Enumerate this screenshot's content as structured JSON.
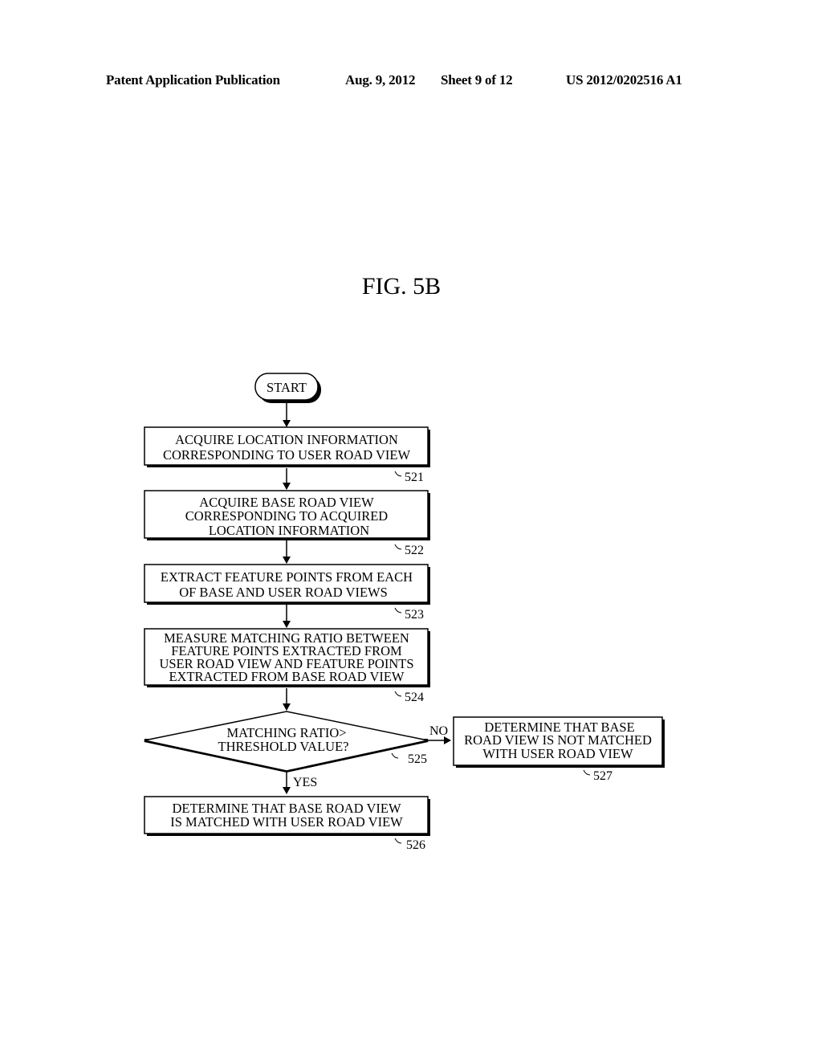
{
  "header": {
    "publication": "Patent Application Publication",
    "date": "Aug. 9, 2012",
    "sheet": "Sheet 9 of 12",
    "pub_number": "US 2012/0202516 A1"
  },
  "figure": {
    "title": "FIG. 5B"
  },
  "flowchart": {
    "start": {
      "label": "START"
    },
    "steps": [
      {
        "ref": "521",
        "lines": [
          "ACQUIRE LOCATION INFORMATION",
          "CORRESPONDING TO USER ROAD VIEW"
        ]
      },
      {
        "ref": "522",
        "lines": [
          "ACQUIRE BASE ROAD VIEW",
          "CORRESPONDING TO ACQUIRED",
          "LOCATION INFORMATION"
        ]
      },
      {
        "ref": "523",
        "lines": [
          "EXTRACT FEATURE POINTS FROM EACH",
          "OF BASE AND USER ROAD VIEWS"
        ]
      },
      {
        "ref": "524",
        "lines": [
          "MEASURE MATCHING RATIO BETWEEN",
          "FEATURE POINTS EXTRACTED FROM",
          "USER ROAD VIEW AND FEATURE POINTS",
          "EXTRACTED FROM BASE ROAD VIEW"
        ]
      }
    ],
    "decision": {
      "ref": "525",
      "lines": [
        "MATCHING RATIO>",
        "THRESHOLD VALUE?"
      ],
      "yes_label": "YES",
      "no_label": "NO"
    },
    "yes_result": {
      "ref": "526",
      "lines": [
        "DETERMINE THAT BASE ROAD VIEW",
        "IS MATCHED WITH USER ROAD VIEW"
      ]
    },
    "no_result": {
      "ref": "527",
      "lines": [
        "DETERMINE THAT BASE",
        "ROAD VIEW IS NOT MATCHED",
        "WITH USER ROAD VIEW"
      ]
    }
  }
}
